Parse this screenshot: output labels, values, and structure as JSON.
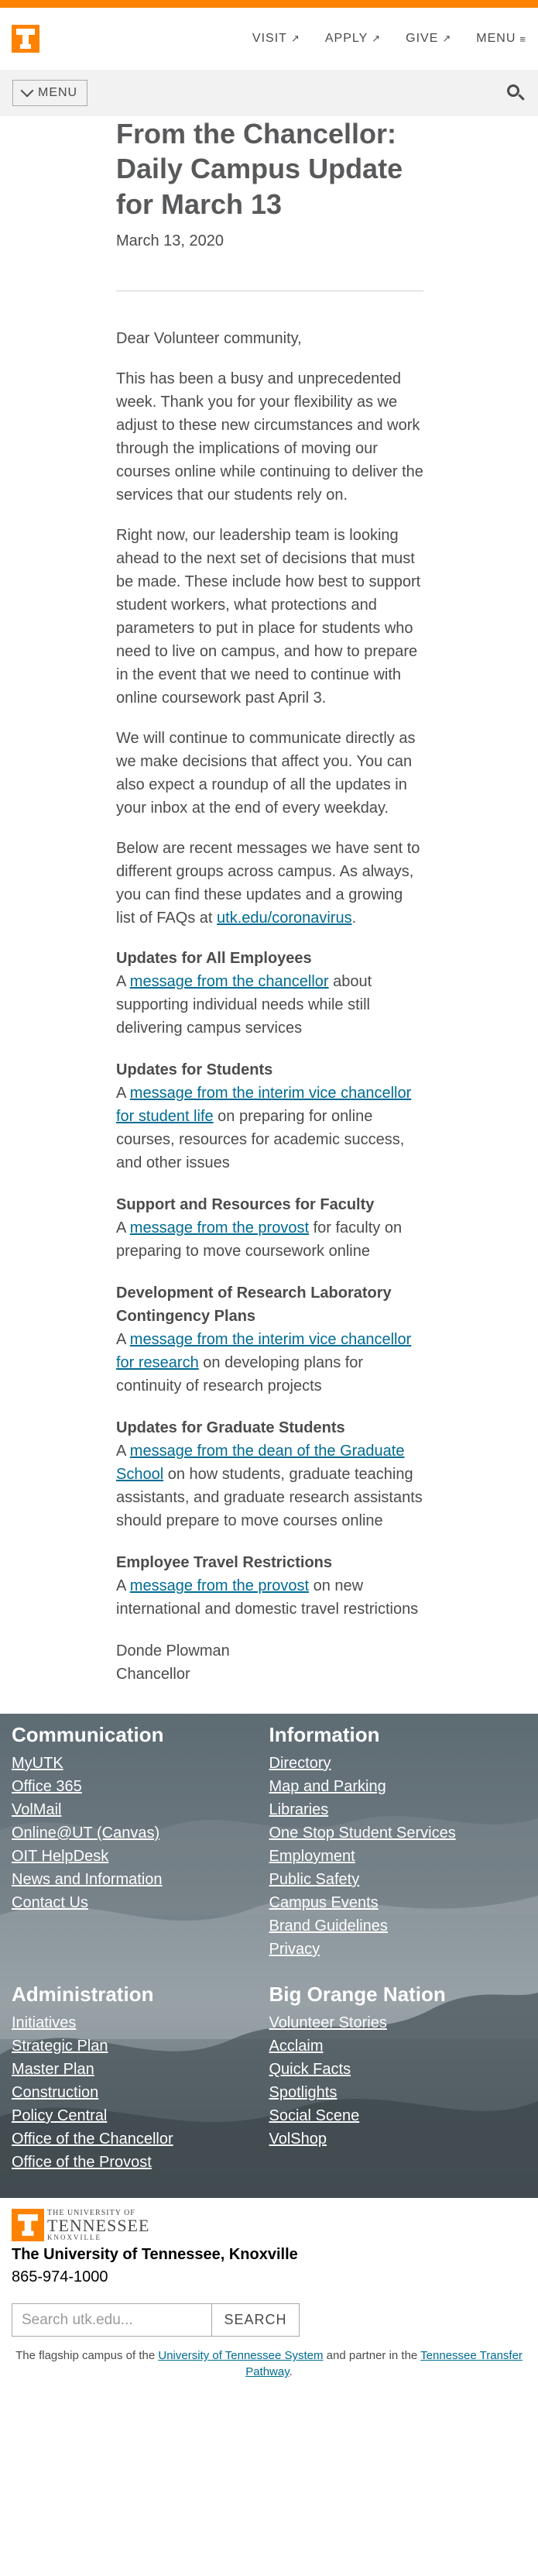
{
  "header": {
    "nav": [
      {
        "label": "VISIT",
        "icon": "external-arrow-icon"
      },
      {
        "label": "APPLY",
        "icon": "external-arrow-icon"
      },
      {
        "label": "GIVE",
        "icon": "external-arrow-icon"
      },
      {
        "label": "MENU",
        "icon": "menu-lines-icon"
      }
    ],
    "logo_letter": "T",
    "accent": "#ff8200"
  },
  "subnav": {
    "menu_label": "MENU"
  },
  "article": {
    "title": "From the Chancellor: Daily Campus Update for March 13",
    "date": "March 13, 2020",
    "paragraphs": [
      "Dear Volunteer community,",
      "This has been a busy and unprecedented week. Thank you for your flexibility as we adjust to these new circumstances and work through the implications of moving our courses online while continuing to deliver the services that our students rely on.",
      "Right now, our leadership team is looking ahead to the next set of decisions that must be made. These include how best to support student workers, what protections and parameters to put in place for students who need to live on campus, and how to prepare in the event that we need to continue with online coursework past April 3.",
      "We will continue to communicate directly as we make decisions that affect you. You can also expect a roundup of all the updates in your inbox at the end of every weekday."
    ],
    "intro_before_link": "Below are recent messages we have sent to different groups across campus. As always, you can find these updates and a growing list of FAQs at ",
    "intro_link": "utk.edu/coronavirus",
    "intro_after_link": ".",
    "sections": [
      {
        "heading": "Updates for All Employees",
        "prefix": "A ",
        "link": "message from the chancellor",
        "suffix": " about supporting individual needs while still delivering campus services"
      },
      {
        "heading": "Updates for Students",
        "prefix": "A ",
        "link": "message from the interim vice chancellor for student life",
        "suffix": " on preparing for online courses, resources for academic success, and other issues"
      },
      {
        "heading": "Support and Resources for Faculty",
        "prefix": "A ",
        "link": "message from the provost",
        "suffix": " for faculty on preparing to move coursework online"
      },
      {
        "heading": "Development of Research Laboratory Contingency Plans",
        "prefix": "A ",
        "link": "message from the interim vice chancellor for research",
        "suffix": " on developing plans for continuity of research projects"
      },
      {
        "heading": "Updates for Graduate Students",
        "prefix": "A ",
        "link": "message from the dean of the Graduate School",
        "suffix": " on how students, graduate teaching assistants, and graduate research assistants should prepare to move courses online"
      },
      {
        "heading": "Employee Travel Restrictions",
        "prefix": "A ",
        "link": "message from the provost",
        "suffix": " on new international and domestic travel restrictions"
      }
    ],
    "signer_name": "Donde Plowman",
    "signer_title": "Chancellor"
  },
  "footer": {
    "columns": [
      {
        "heading": "Communication",
        "links": [
          "MyUTK",
          "Office 365",
          "VolMail",
          "Online@UT (Canvas)",
          "OIT HelpDesk",
          "News and Information",
          "Contact Us"
        ]
      },
      {
        "heading": "Information",
        "links": [
          "Directory",
          "Map and Parking",
          "Libraries",
          "One Stop Student Services",
          "Employment",
          "Public Safety",
          "Campus Events",
          "Brand Guidelines",
          "Privacy"
        ]
      },
      {
        "heading": "Administration",
        "links": [
          "Initiatives",
          "Strategic Plan",
          "Master Plan",
          "Construction",
          "Policy Central",
          "Office of the Chancellor",
          "Office of the Provost"
        ]
      },
      {
        "heading": "Big Orange Nation",
        "links": [
          "Volunteer Stories",
          "Acclaim",
          "Quick Facts",
          "Spotlights",
          "Social Scene",
          "VolShop"
        ]
      }
    ]
  },
  "bottom": {
    "logo_line1": "THE UNIVERSITY OF",
    "logo_line2": "TENNESSEE",
    "logo_line3": "KNOXVILLE",
    "university_name": "The University of Tennessee, Knoxville",
    "phone": "865-974-1000",
    "search_placeholder": "Search utk.edu...",
    "search_button": "SEARCH",
    "tagline_before": "The flagship campus of the ",
    "tagline_link1": "University of Tennessee System",
    "tagline_middle": " and partner in the ",
    "tagline_link2": "Tennessee Transfer Pathway",
    "tagline_after": "."
  }
}
